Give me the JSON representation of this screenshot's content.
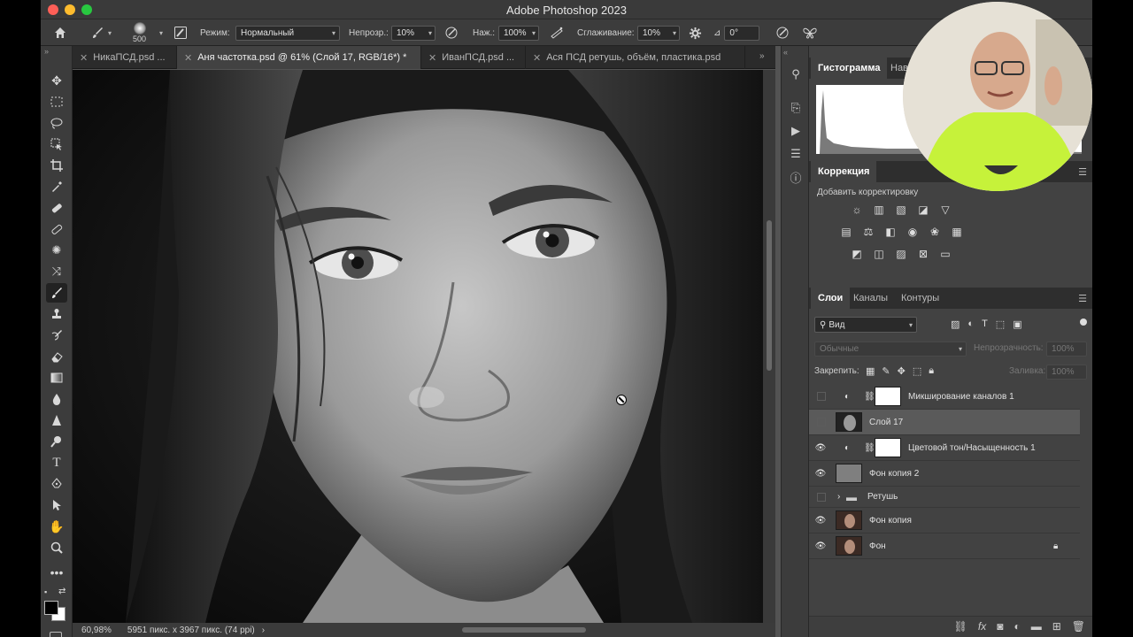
{
  "app": {
    "title": "Adobe Photoshop 2023"
  },
  "options": {
    "brush_size": "500",
    "mode_label": "Режим:",
    "mode_value": "Нормальный",
    "opacity_label": "Непрозр.:",
    "opacity_value": "10%",
    "pressure_label": "Наж.:",
    "pressure_value": "100%",
    "smoothing_label": "Сглаживание:",
    "smoothing_value": "10%",
    "angle_value": "0°"
  },
  "tabs": [
    {
      "label": "НикаПСД.psd ...",
      "active": false
    },
    {
      "label": "Аня частотка.psd @ 61% (Слой 17, RGB/16*) *",
      "active": true
    },
    {
      "label": "ИванПСД.psd ...",
      "active": false
    },
    {
      "label": "Ася ПСД ретушь, объём, пластика.psd",
      "active": false
    }
  ],
  "status": {
    "zoom": "60,98%",
    "dimensions": "5951 пикс. x 3967 пикс. (74 ppi)",
    "arrow": "›"
  },
  "histogram_panel": {
    "tab1": "Гистограмма",
    "tab2": "Нав"
  },
  "adjustments_panel": {
    "title": "Коррекция",
    "subtitle": "Добавить корректировку"
  },
  "layers_panel": {
    "tabs": [
      "Слои",
      "Каналы",
      "Контуры"
    ],
    "filter_label": "Вид",
    "blend_mode": "Обычные",
    "opacity_label": "Непрозрачность:",
    "opacity_value": "100%",
    "lock_label": "Закрепить:",
    "fill_label": "Заливка:",
    "fill_value": "100%",
    "layers": [
      {
        "name": "Микширование каналов 1",
        "visible": false,
        "kind": "adjustment",
        "selected": false
      },
      {
        "name": "Слой 17",
        "visible": false,
        "kind": "pixel",
        "selected": true
      },
      {
        "name": "Цветовой тон/Насыщенность 1",
        "visible": true,
        "kind": "adjustment",
        "selected": false
      },
      {
        "name": "Фон копия 2",
        "visible": true,
        "kind": "gray",
        "selected": false
      },
      {
        "name": "Ретушь",
        "visible": false,
        "kind": "group",
        "selected": false
      },
      {
        "name": "Фон копия",
        "visible": true,
        "kind": "photo",
        "selected": false
      },
      {
        "name": "Фон",
        "visible": true,
        "kind": "photo",
        "selected": false,
        "locked": true
      }
    ]
  }
}
